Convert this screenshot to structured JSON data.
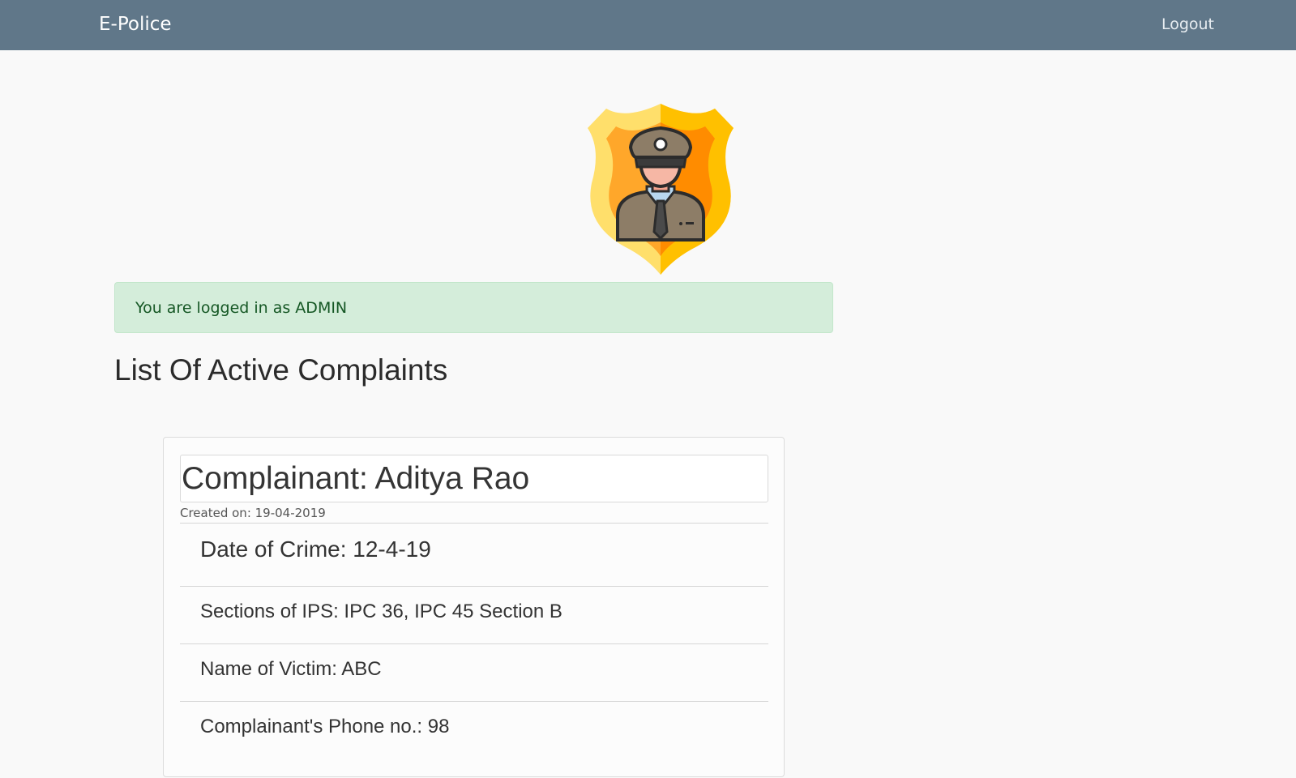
{
  "navbar": {
    "brand": "E-Police",
    "logout": "Logout"
  },
  "logo": {
    "icon": "police-officer-shield-icon",
    "colors": {
      "shield_light": "#ffe169",
      "shield_gold": "#ffc107",
      "shield_orange": "#ff8c00",
      "uniform": "#8d7d67",
      "skin": "#f6b7a5"
    }
  },
  "alert": {
    "text": "You are logged in as ADMIN"
  },
  "page": {
    "title": "List Of Active Complaints"
  },
  "complaint": {
    "complainant": "Complainant: Aditya Rao",
    "created_on": "Created on: 19-04-2019",
    "date_of_crime": "Date of Crime: 12-4-19",
    "sections": "Sections of IPS: IPC 36, IPC 45 Section B",
    "victim": "Name of Victim: ABC",
    "phone": "Complainant's Phone no.: 98"
  }
}
